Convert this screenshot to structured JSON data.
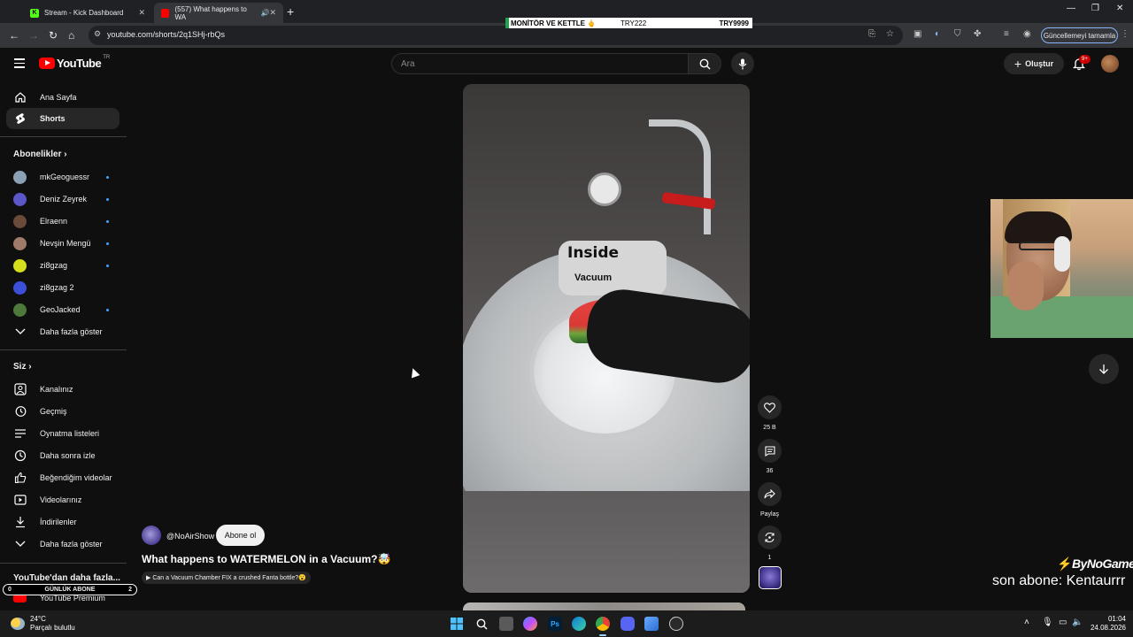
{
  "browser": {
    "tabs": [
      {
        "title": "Stream - Kick Dashboard",
        "favicon": "kick-icon",
        "favicon_letter": "K",
        "favicon_color": "#53fc18",
        "active": false
      },
      {
        "title": "(557) What happens to WA",
        "favicon": "youtube-icon",
        "favicon_color": "#ff0000",
        "active": true
      }
    ],
    "new_tab": "+",
    "url": "youtube.com/shorts/2q1SHj-rbQs",
    "update_label": "Güncellemeyi tamamla"
  },
  "ticker": {
    "text1": "MONİTÖR VE KETTLE",
    "emoji": "🖕",
    "price1": "TRY222",
    "price2": "TRY9999"
  },
  "youtube": {
    "logo_text": "YouTube",
    "country": "TR",
    "search_placeholder": "Ara",
    "create_label": "Oluştur",
    "notification_badge": "9+"
  },
  "sidebar": {
    "main": [
      {
        "label": "Ana Sayfa",
        "icon": "home-icon"
      },
      {
        "label": "Shorts",
        "icon": "shorts-icon",
        "active": true
      }
    ],
    "subscriptions_title": "Abonelikler",
    "subscriptions": [
      {
        "label": "mkGeoguessr",
        "color": "#8aa0b4"
      },
      {
        "label": "Deniz Zeyrek",
        "color": "#5b57c9"
      },
      {
        "label": "Elraenn",
        "color": "#6b4a3a"
      },
      {
        "label": "Nevşin Mengü",
        "color": "#a07a68"
      },
      {
        "label": "zi8gzag",
        "color": "#d4e01b"
      },
      {
        "label": "zi8gzag 2",
        "color": "#3b4fd8"
      },
      {
        "label": "GeoJacked",
        "color": "#4d7a3a"
      }
    ],
    "show_more": "Daha fazla göster",
    "you_title": "Siz",
    "you": [
      {
        "label": "Kanalınız",
        "icon": "channel-icon"
      },
      {
        "label": "Geçmiş",
        "icon": "history-icon"
      },
      {
        "label": "Oynatma listeleri",
        "icon": "playlists-icon"
      },
      {
        "label": "Daha sonra izle",
        "icon": "watch-later-icon"
      },
      {
        "label": "Beğendiğim videolar",
        "icon": "liked-icon"
      },
      {
        "label": "Videolarınız",
        "icon": "your-videos-icon"
      },
      {
        "label": "İndirilenler",
        "icon": "downloads-icon"
      }
    ],
    "show_more_2": "Daha fazla göster",
    "more_from_yt": "YouTube'dan daha fazla...",
    "premium": "YouTube Premium"
  },
  "daily_sub": {
    "left": "0",
    "label": "GÜNLÜK ABONE",
    "right": "2"
  },
  "video": {
    "label_line1": "Inside",
    "label_line2": "Vacuum",
    "channel_handle": "@NoAirShow",
    "subscribe_label": "Abone ol",
    "title": "What happens to WATERMELON in a Vacuum?🤯",
    "related_chip": "▶ Can a Vacuum Chamber FIX a crushed Fanta bottle?😮"
  },
  "actions": {
    "like_count": "25 B",
    "comment_count": "36",
    "share_label": "Paylaş",
    "remix_count": "1"
  },
  "overlay": {
    "brand": "ByNoGame",
    "last_sub": "son abone: Kentaurrr"
  },
  "taskbar": {
    "temp": "24°C",
    "weather": "Parçalı bulutlu",
    "time": "01:04",
    "date": "24.08.2026"
  }
}
